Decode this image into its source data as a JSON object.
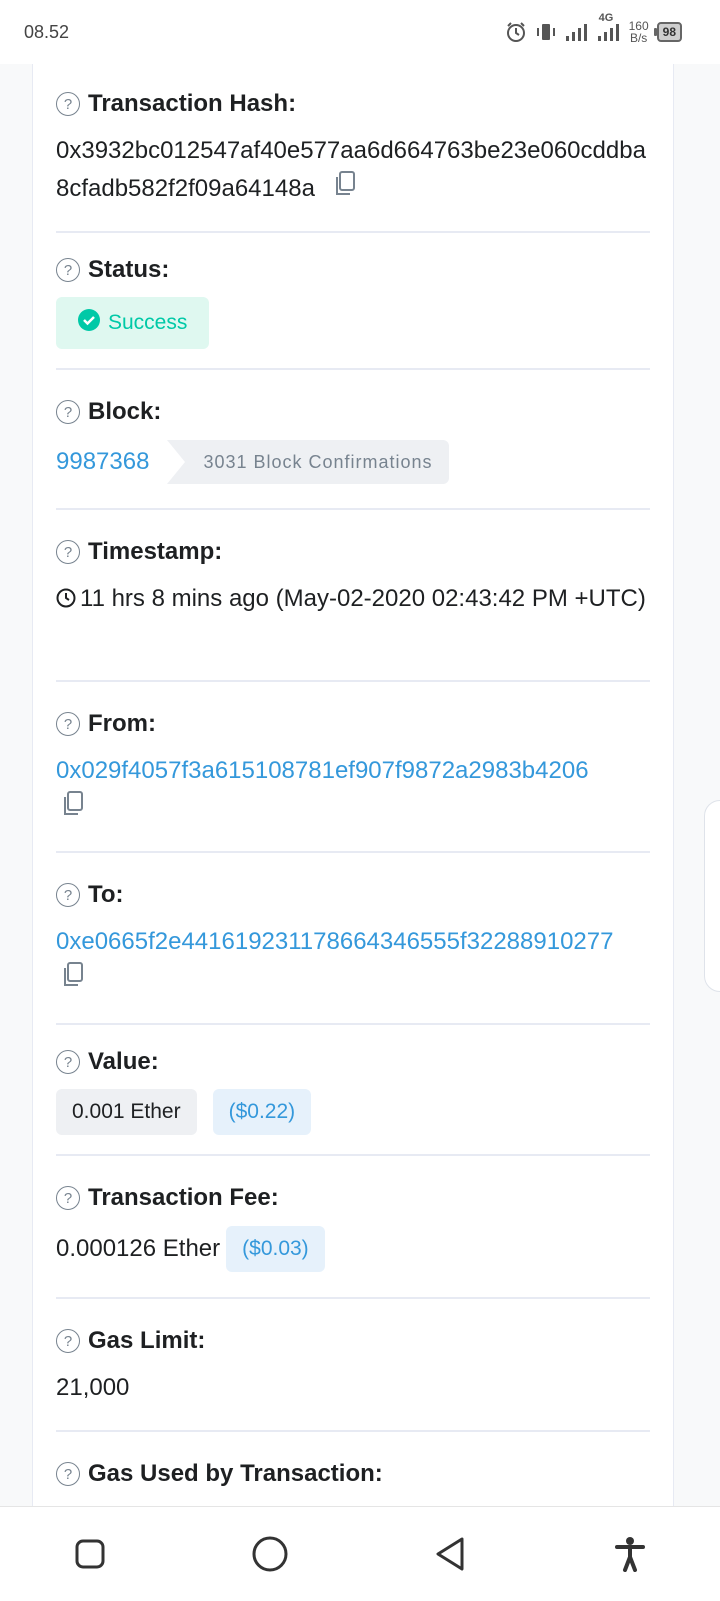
{
  "status_bar": {
    "time": "08.52",
    "network": "4G",
    "speed_value": "160",
    "speed_unit": "B/s",
    "battery": "98"
  },
  "fields": {
    "tx_hash": {
      "label": "Transaction Hash:",
      "value": "0x3932bc012547af40e577aa6d664763be23e060cddba8cfadb582f2f09a64148a"
    },
    "status": {
      "label": "Status:",
      "value": "Success"
    },
    "block": {
      "label": "Block:",
      "number": "9987368",
      "confirmations": "3031 Block Confirmations"
    },
    "timestamp": {
      "label": "Timestamp:",
      "value": "11 hrs 8 mins ago (May-02-2020 02:43:42 PM +UTC)"
    },
    "from": {
      "label": "From:",
      "value": "0x029f4057f3a615108781ef907f9872a2983b4206"
    },
    "to": {
      "label": "To:",
      "value": "0xe0665f2e441619231178664346555f32288910277"
    },
    "value": {
      "label": "Value:",
      "amount": "0.001 Ether",
      "usd": "($0.22)"
    },
    "fee": {
      "label": "Transaction Fee:",
      "amount": "0.000126 Ether",
      "usd": "($0.03)"
    },
    "gas_limit": {
      "label": "Gas Limit:",
      "value": "21,000"
    },
    "gas_used": {
      "label": "Gas Used by Transaction:"
    }
  },
  "icons": {
    "help": "question-circle-icon",
    "copy": "copy-icon",
    "success": "check-circle-icon",
    "clock": "clock-icon"
  },
  "colors": {
    "link": "#3498db",
    "success": "#00c9a7",
    "success_bg": "#dff8f0",
    "muted": "#77838f"
  }
}
